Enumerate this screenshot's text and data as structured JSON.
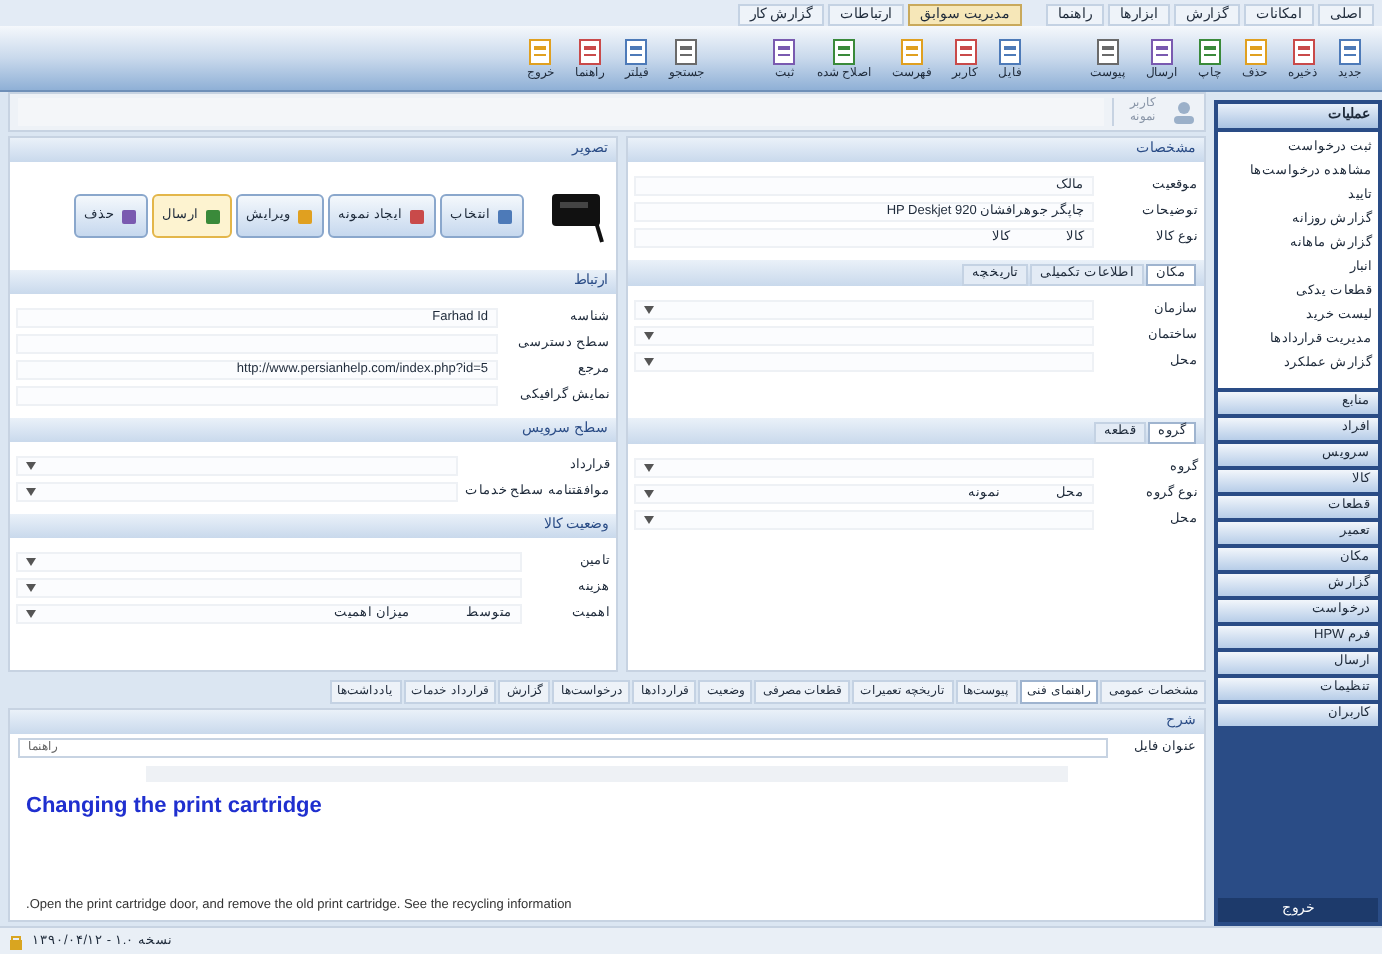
{
  "ribbon": {
    "tabs": [
      {
        "label": "اصلی",
        "selected": false
      },
      {
        "label": "امکانات",
        "selected": false
      },
      {
        "label": "گزارش",
        "selected": false
      },
      {
        "label": "ابزارها",
        "selected": false
      },
      {
        "label": "راهنما",
        "selected": false
      },
      {
        "label": "مدیریت سوابق",
        "selected": true
      },
      {
        "label": "ارتباطات",
        "selected": false
      },
      {
        "label": "گزارش کار",
        "selected": false
      }
    ],
    "buttons": [
      {
        "label": "جدید"
      },
      {
        "label": "ذخیره"
      },
      {
        "label": "حذف"
      },
      {
        "label": "چاپ"
      },
      {
        "label": "ارسال"
      },
      {
        "label": "پیوست"
      },
      {
        "label": "فایل"
      },
      {
        "label": "کاربر"
      },
      {
        "label": "فهرست"
      },
      {
        "label": "اصلاح شده"
      },
      {
        "label": "ثبت"
      },
      {
        "label": "جستجو"
      },
      {
        "label": "فیلتر"
      },
      {
        "label": "راهنما"
      },
      {
        "label": "خروج"
      }
    ]
  },
  "address": {
    "label": "کاربر",
    "value": "نمونه"
  },
  "sidebar": {
    "header": "عملیات",
    "items": [
      "ثبت درخواست",
      "مشاهده درخواست‌ها",
      "تایید",
      "گزارش روزانه",
      "گزارش ماهانه",
      "انبار",
      "قطعات یدکی",
      "لیست خرید",
      "مدیریت قراردادها",
      "گزارش عملکرد"
    ],
    "nav": [
      {
        "label": "منابع",
        "selected": false
      },
      {
        "label": "افراد",
        "selected": false
      },
      {
        "label": "سرویس",
        "selected": false
      },
      {
        "label": "کالا",
        "selected": false
      },
      {
        "label": "قطعات",
        "selected": false
      },
      {
        "label": "تعمیر",
        "selected": false
      },
      {
        "label": "مکان",
        "selected": false
      },
      {
        "label": "گزارش",
        "selected": false
      },
      {
        "label": "درخواست",
        "selected": false
      },
      {
        "label": "فرم HPW",
        "selected": false
      },
      {
        "label": "ارسال",
        "selected": false
      },
      {
        "label": "تنظیمات",
        "selected": false
      },
      {
        "label": "کاربران",
        "selected": false
      }
    ],
    "footer": "خروج"
  },
  "details": {
    "title": "مشخصات",
    "rows": [
      {
        "label": "موقعیت",
        "value": "مالک"
      },
      {
        "label": "توضیحات",
        "value": "چاپگر جوهرافشان HP Deskjet 920"
      },
      {
        "label": "نوع کالا",
        "value": "کالا",
        "extra": "کالا"
      }
    ]
  },
  "location": {
    "tabs": [
      {
        "label": "مکان",
        "selected": true
      },
      {
        "label": "اطلاعات تکمیلی",
        "selected": false
      },
      {
        "label": "تاریخچه",
        "selected": false
      }
    ],
    "rows": [
      {
        "label": "سازمان"
      },
      {
        "label": "ساختمان"
      },
      {
        "label": "محل"
      }
    ]
  },
  "group": {
    "tabs": [
      {
        "label": "گروه",
        "selected": true
      },
      {
        "label": "قطعه",
        "selected": false
      }
    ],
    "rows": [
      {
        "label": "گروه"
      },
      {
        "label": "نوع گروه",
        "value": "محل",
        "extra": "نمونه"
      },
      {
        "label": "محل"
      }
    ]
  },
  "image": {
    "title": "تصویر",
    "buttons": [
      {
        "label": "انتخاب",
        "selected": false
      },
      {
        "label": "ایجاد نمونه",
        "selected": false
      },
      {
        "label": "ویرایش",
        "selected": false
      },
      {
        "label": "ارسال",
        "selected": true
      },
      {
        "label": "حذف",
        "selected": false
      }
    ]
  },
  "contact": {
    "title": "ارتباط",
    "rows": [
      {
        "label": "شناسه",
        "value": "Farhad Id"
      },
      {
        "label": "سطح دسترسی"
      },
      {
        "label": "مرجع",
        "value": "http://www.persianhelp.com/index.php?id=5"
      },
      {
        "label": "نمایش گرافیکی"
      }
    ]
  },
  "service": {
    "title": "سطح سرویس",
    "rows": [
      {
        "label": "قرارداد"
      },
      {
        "label": "موافقتنامه سطح خدمات"
      }
    ]
  },
  "status": {
    "title": "وضعیت کالا",
    "rows": [
      {
        "label": "تامین"
      },
      {
        "label": "هزینه"
      },
      {
        "label": "اهمیت",
        "value": "متوسط",
        "extra": "میزان اهمیت"
      }
    ]
  },
  "bottom_tabs": [
    {
      "label": "مشخصات عمومی",
      "selected": false
    },
    {
      "label": "راهنمای فنی",
      "selected": true
    },
    {
      "label": "پیوست‌ها",
      "selected": false
    },
    {
      "label": "تاریخچه تعمیرات",
      "selected": false
    },
    {
      "label": "قطعات مصرفی",
      "selected": false
    },
    {
      "label": "وضعیت",
      "selected": false
    },
    {
      "label": "قراردادها",
      "selected": false
    },
    {
      "label": "درخواست‌ها",
      "selected": false
    },
    {
      "label": "گزارش",
      "selected": false
    },
    {
      "label": "قرارداد خدمات",
      "selected": false
    },
    {
      "label": "یادداشت‌ها",
      "selected": false
    }
  ],
  "description": {
    "title": "شرح",
    "file_label": "عنوان فایل",
    "file_value": "راهنما",
    "doc_heading": "Changing the print cartridge",
    "doc_text": "Open the print cartridge door, and remove the old print cartridge. See the recycling information."
  },
  "status_bar": "نسخه ۱.۰ - ۱۳۹۰/۰۴/۱۲"
}
